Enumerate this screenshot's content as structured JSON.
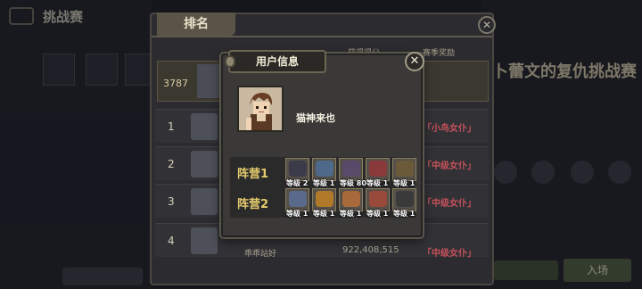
{
  "background": {
    "left_title": "挑战赛",
    "right_big_title": "卜蕾文的复仇挑战赛",
    "enter_button": "入场"
  },
  "rank_panel": {
    "tab_label": "排名",
    "col_score": "获得得分",
    "col_reward": "赛季奖励",
    "self_score": "3787",
    "rows": [
      {
        "rank": "1",
        "reward": "「小鸟女仆」"
      },
      {
        "rank": "2",
        "reward": "「中级女仆」"
      },
      {
        "rank": "3",
        "reward": "「中级女仆」"
      },
      {
        "rank": "4",
        "reward": "「中级女仆」",
        "name": "乖乖站好",
        "score": "922,408,515"
      }
    ]
  },
  "user_modal": {
    "title": "用户信息",
    "close_icon": "close-x-icon",
    "user_name": "猫神来也",
    "teams": [
      {
        "label": "阵营1",
        "heroes": [
          {
            "level": "等级 2",
            "color": "#3b3b4a"
          },
          {
            "level": "等级 1",
            "color": "#4e6a8a"
          },
          {
            "level": "等级 80",
            "color": "#5a4a6a"
          },
          {
            "level": "等级 1",
            "color": "#8a3a3a"
          },
          {
            "level": "等级 1",
            "color": "#6a5a3a"
          }
        ]
      },
      {
        "label": "阵营2",
        "heroes": [
          {
            "level": "等级 1",
            "color": "#5a6a8a"
          },
          {
            "level": "等级 1",
            "color": "#b07a2a"
          },
          {
            "level": "等级 1",
            "color": "#a86a3a"
          },
          {
            "level": "等级 1",
            "color": "#9a4a3a"
          },
          {
            "level": "等级 1",
            "color": "#3a3a3a"
          }
        ]
      }
    ]
  }
}
